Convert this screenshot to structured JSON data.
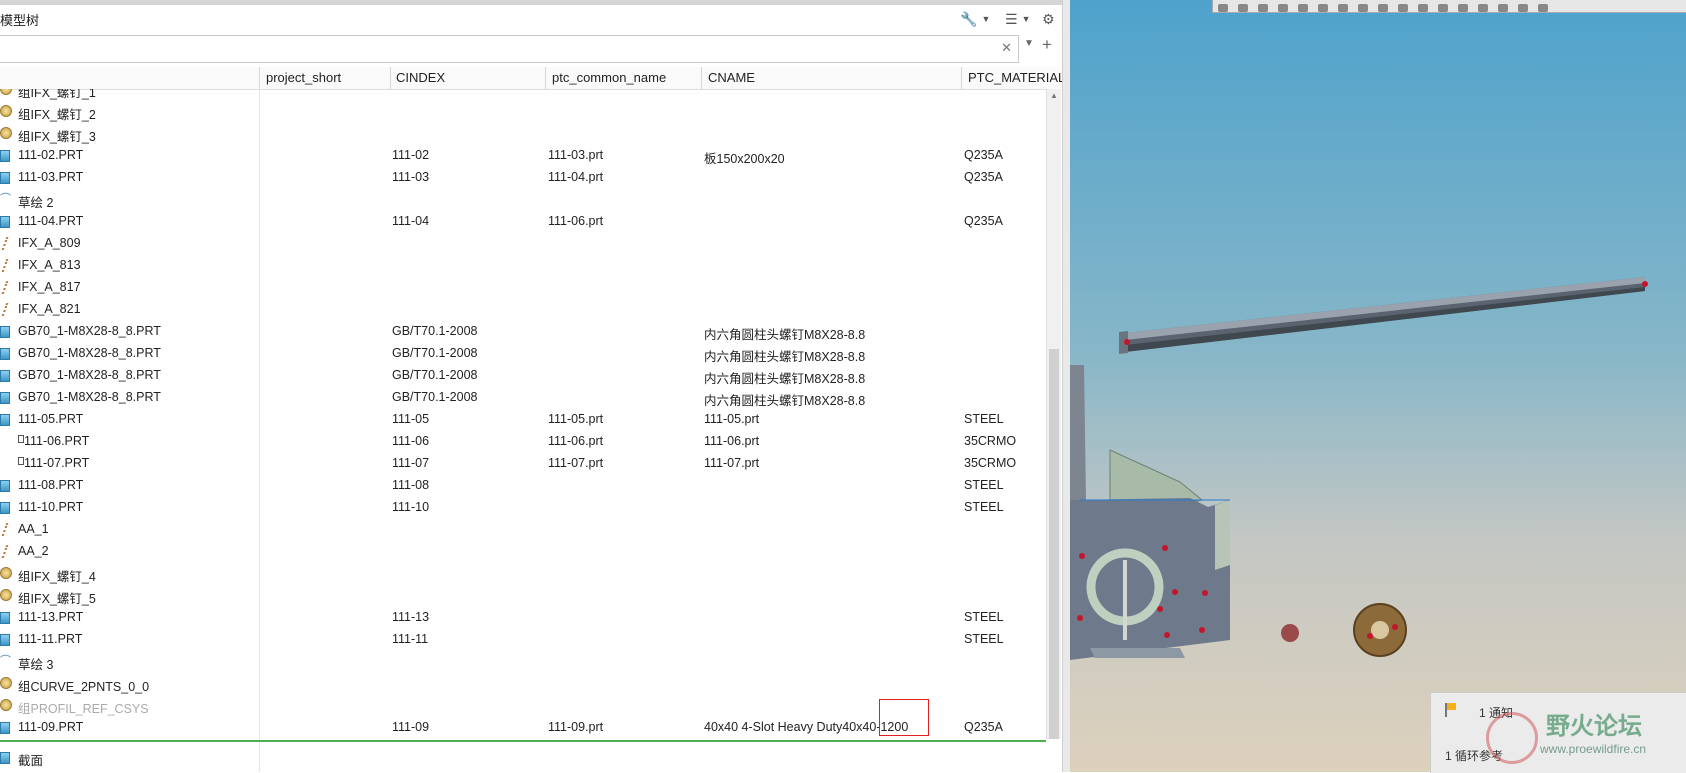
{
  "panel": {
    "title": "模型树",
    "columns": [
      "project_short",
      "CINDEX",
      "ptc_common_name",
      "CNAME",
      "PTC_MATERIAL_NAME"
    ]
  },
  "tree_rows": [
    {
      "icon": "group-icon",
      "name": "组IFX_螺钉_1",
      "project_short": "",
      "cindex": "",
      "common_name": "",
      "cname": "",
      "material": ""
    },
    {
      "icon": "group-icon",
      "name": "组IFX_螺钉_2",
      "project_short": "",
      "cindex": "",
      "common_name": "",
      "cname": "",
      "material": ""
    },
    {
      "icon": "group-icon",
      "name": "组IFX_螺钉_3",
      "project_short": "",
      "cindex": "",
      "common_name": "",
      "cname": "",
      "material": ""
    },
    {
      "icon": "part-icon",
      "name": "111-02.PRT",
      "project_short": "",
      "cindex": "111-02",
      "common_name": "111-03.prt",
      "cname": "板150x200x20",
      "material": "Q235A"
    },
    {
      "icon": "part-icon",
      "name": "111-03.PRT",
      "project_short": "",
      "cindex": "111-03",
      "common_name": "111-04.prt",
      "cname": "",
      "material": "Q235A"
    },
    {
      "icon": "sketch-icon",
      "name": "草绘 2",
      "project_short": "",
      "cindex": "",
      "common_name": "",
      "cname": "",
      "material": ""
    },
    {
      "icon": "part-icon",
      "name": "111-04.PRT",
      "project_short": "",
      "cindex": "111-04",
      "common_name": "111-06.prt",
      "cname": "",
      "material": "Q235A"
    },
    {
      "icon": "axis-icon",
      "name": "IFX_A_809",
      "project_short": "",
      "cindex": "",
      "common_name": "",
      "cname": "",
      "material": ""
    },
    {
      "icon": "axis-icon",
      "name": "IFX_A_813",
      "project_short": "",
      "cindex": "",
      "common_name": "",
      "cname": "",
      "material": ""
    },
    {
      "icon": "axis-icon",
      "name": "IFX_A_817",
      "project_short": "",
      "cindex": "",
      "common_name": "",
      "cname": "",
      "material": ""
    },
    {
      "icon": "axis-icon",
      "name": "IFX_A_821",
      "project_short": "",
      "cindex": "",
      "common_name": "",
      "cname": "",
      "material": ""
    },
    {
      "icon": "part-icon",
      "name": "GB70_1-M8X28-8_8.PRT",
      "project_short": "",
      "cindex": "GB/T70.1-2008",
      "common_name": "",
      "cname": "内六角圆柱头螺钉M8X28-8.8",
      "material": ""
    },
    {
      "icon": "part-icon",
      "name": "GB70_1-M8X28-8_8.PRT",
      "project_short": "",
      "cindex": "GB/T70.1-2008",
      "common_name": "",
      "cname": "内六角圆柱头螺钉M8X28-8.8",
      "material": ""
    },
    {
      "icon": "part-icon",
      "name": "GB70_1-M8X28-8_8.PRT",
      "project_short": "",
      "cindex": "GB/T70.1-2008",
      "common_name": "",
      "cname": "内六角圆柱头螺钉M8X28-8.8",
      "material": ""
    },
    {
      "icon": "part-icon",
      "name": "GB70_1-M8X28-8_8.PRT",
      "project_short": "",
      "cindex": "GB/T70.1-2008",
      "common_name": "",
      "cname": "内六角圆柱头螺钉M8X28-8.8",
      "material": ""
    },
    {
      "icon": "part-icon",
      "name": "111-05.PRT",
      "project_short": "",
      "cindex": "111-05",
      "common_name": "111-05.prt",
      "cname": "111-05.prt",
      "material": "STEEL"
    },
    {
      "icon": "small-part-icon",
      "name": "111-06.PRT",
      "project_short": "",
      "cindex": "111-06",
      "common_name": "111-06.prt",
      "cname": "111-06.prt",
      "material": "35CRMO"
    },
    {
      "icon": "small-part-icon",
      "name": "111-07.PRT",
      "project_short": "",
      "cindex": "111-07",
      "common_name": "111-07.prt",
      "cname": "111-07.prt",
      "material": "35CRMO"
    },
    {
      "icon": "part-icon",
      "name": "111-08.PRT",
      "project_short": "",
      "cindex": "111-08",
      "common_name": "",
      "cname": "",
      "material": "STEEL"
    },
    {
      "icon": "part-icon",
      "name": "111-10.PRT",
      "project_short": "",
      "cindex": "111-10",
      "common_name": "",
      "cname": "",
      "material": "STEEL"
    },
    {
      "icon": "axis-icon",
      "name": "AA_1",
      "project_short": "",
      "cindex": "",
      "common_name": "",
      "cname": "",
      "material": ""
    },
    {
      "icon": "axis-icon",
      "name": "AA_2",
      "project_short": "",
      "cindex": "",
      "common_name": "",
      "cname": "",
      "material": ""
    },
    {
      "icon": "group-icon",
      "name": "组IFX_螺钉_4",
      "project_short": "",
      "cindex": "",
      "common_name": "",
      "cname": "",
      "material": ""
    },
    {
      "icon": "group-icon",
      "name": "组IFX_螺钉_5",
      "project_short": "",
      "cindex": "",
      "common_name": "",
      "cname": "",
      "material": ""
    },
    {
      "icon": "part-icon",
      "name": "111-13.PRT",
      "project_short": "",
      "cindex": "111-13",
      "common_name": "",
      "cname": "",
      "material": "STEEL"
    },
    {
      "icon": "part-icon",
      "name": "111-11.PRT",
      "project_short": "",
      "cindex": "111-11",
      "common_name": "",
      "cname": "",
      "material": "STEEL"
    },
    {
      "icon": "sketch-icon",
      "name": "草绘 3",
      "project_short": "",
      "cindex": "",
      "common_name": "",
      "cname": "",
      "material": ""
    },
    {
      "icon": "group-icon",
      "name": "组CURVE_2PNTS_0_0",
      "project_short": "",
      "cindex": "",
      "common_name": "",
      "cname": "",
      "material": ""
    },
    {
      "icon": "group-icon",
      "name": "组PROFIL_REF_CSYS",
      "greyed": true,
      "project_short": "",
      "cindex": "",
      "common_name": "",
      "cname": "",
      "material": ""
    },
    {
      "icon": "part-icon",
      "name": "111-09.PRT",
      "project_short": "",
      "cindex": "111-09",
      "common_name": "111-09.prt",
      "cname": "40x40 4-Slot Heavy Duty40x40-1200",
      "material": "Q235A"
    }
  ],
  "bottom_row": {
    "name": "截面"
  },
  "notification": {
    "title": "1 通知",
    "detail": "1 循环参考"
  },
  "watermark": {
    "title": "野火论坛",
    "url": "www.proewildfire.cn"
  },
  "colors": {
    "viewport_top": "#4ea2cc",
    "viewport_bottom": "#ddd1bc",
    "selection_line": "#4caf50",
    "highlight_box": "#e02020"
  }
}
